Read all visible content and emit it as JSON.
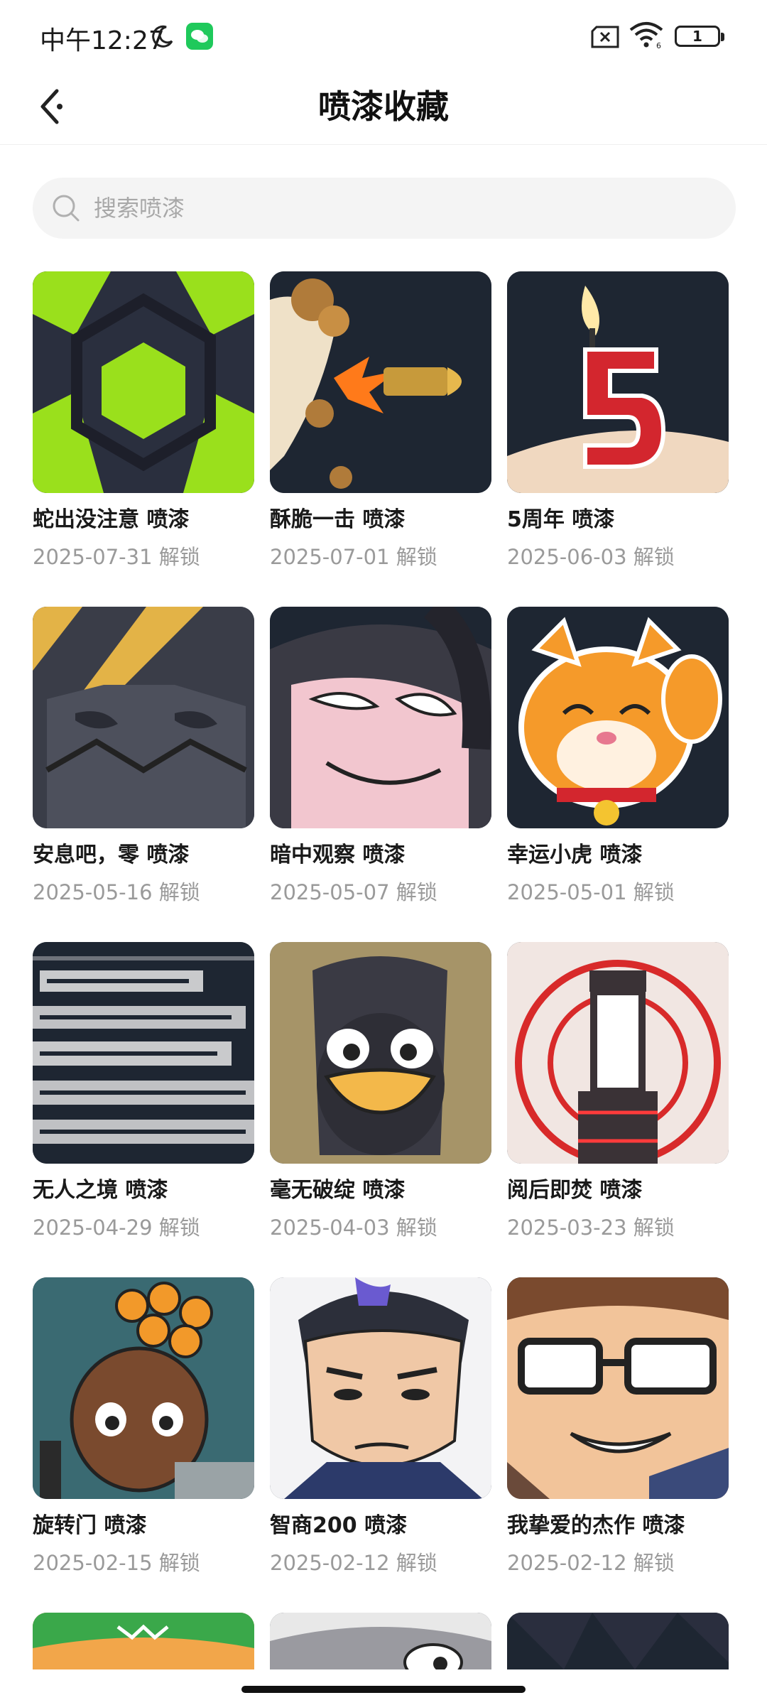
{
  "status_bar": {
    "time": "中午12:27",
    "battery": "1"
  },
  "header": {
    "title": "喷漆收藏"
  },
  "search": {
    "placeholder": "搜索喷漆"
  },
  "sprays": [
    {
      "title": "蛇出没注意 喷漆",
      "date": "2025-07-31 解锁",
      "icon": "hexagon-spray-icon"
    },
    {
      "title": "酥脆一击 喷漆",
      "date": "2025-07-01 解锁",
      "icon": "bullet-spray-icon"
    },
    {
      "title": "5周年 喷漆",
      "date": "2025-06-03 解锁",
      "icon": "birthday-candle-spray-icon"
    },
    {
      "title": "安息吧，零 喷漆",
      "date": "2025-05-16 解锁",
      "icon": "robot-face-spray-icon"
    },
    {
      "title": "暗中观察 喷漆",
      "date": "2025-05-07 解锁",
      "icon": "peeking-face-spray-icon"
    },
    {
      "title": "幸运小虎 喷漆",
      "date": "2025-05-01 解锁",
      "icon": "lucky-tiger-spray-icon"
    },
    {
      "title": "无人之境 喷漆",
      "date": "2025-04-29 解锁",
      "icon": "text-collage-spray-icon"
    },
    {
      "title": "毫无破绽 喷漆",
      "date": "2025-04-03 解锁",
      "icon": "penguin-spray-icon"
    },
    {
      "title": "阅后即焚 喷漆",
      "date": "2025-03-23 解锁",
      "icon": "target-tower-spray-icon"
    },
    {
      "title": "旋转门 喷漆",
      "date": "2025-02-15 解锁",
      "icon": "agent-chibi-spray-icon"
    },
    {
      "title": "智商200 喷漆",
      "date": "2025-02-12 解锁",
      "icon": "thinking-man-spray-icon"
    },
    {
      "title": "我挚爱的杰作 喷漆",
      "date": "2025-02-12 解锁",
      "icon": "glasses-man-spray-icon"
    },
    {
      "title": "",
      "date": "",
      "icon": "green-bandana-spray-icon"
    },
    {
      "title": "",
      "date": "",
      "icon": "raccoon-spray-icon"
    },
    {
      "title": "",
      "date": "",
      "icon": "dark-hair-spray-icon"
    }
  ],
  "colors": {
    "accent_green": "#9ae01c",
    "thumb_dark": "#1e2632",
    "date_gray": "#9a9a9a"
  }
}
